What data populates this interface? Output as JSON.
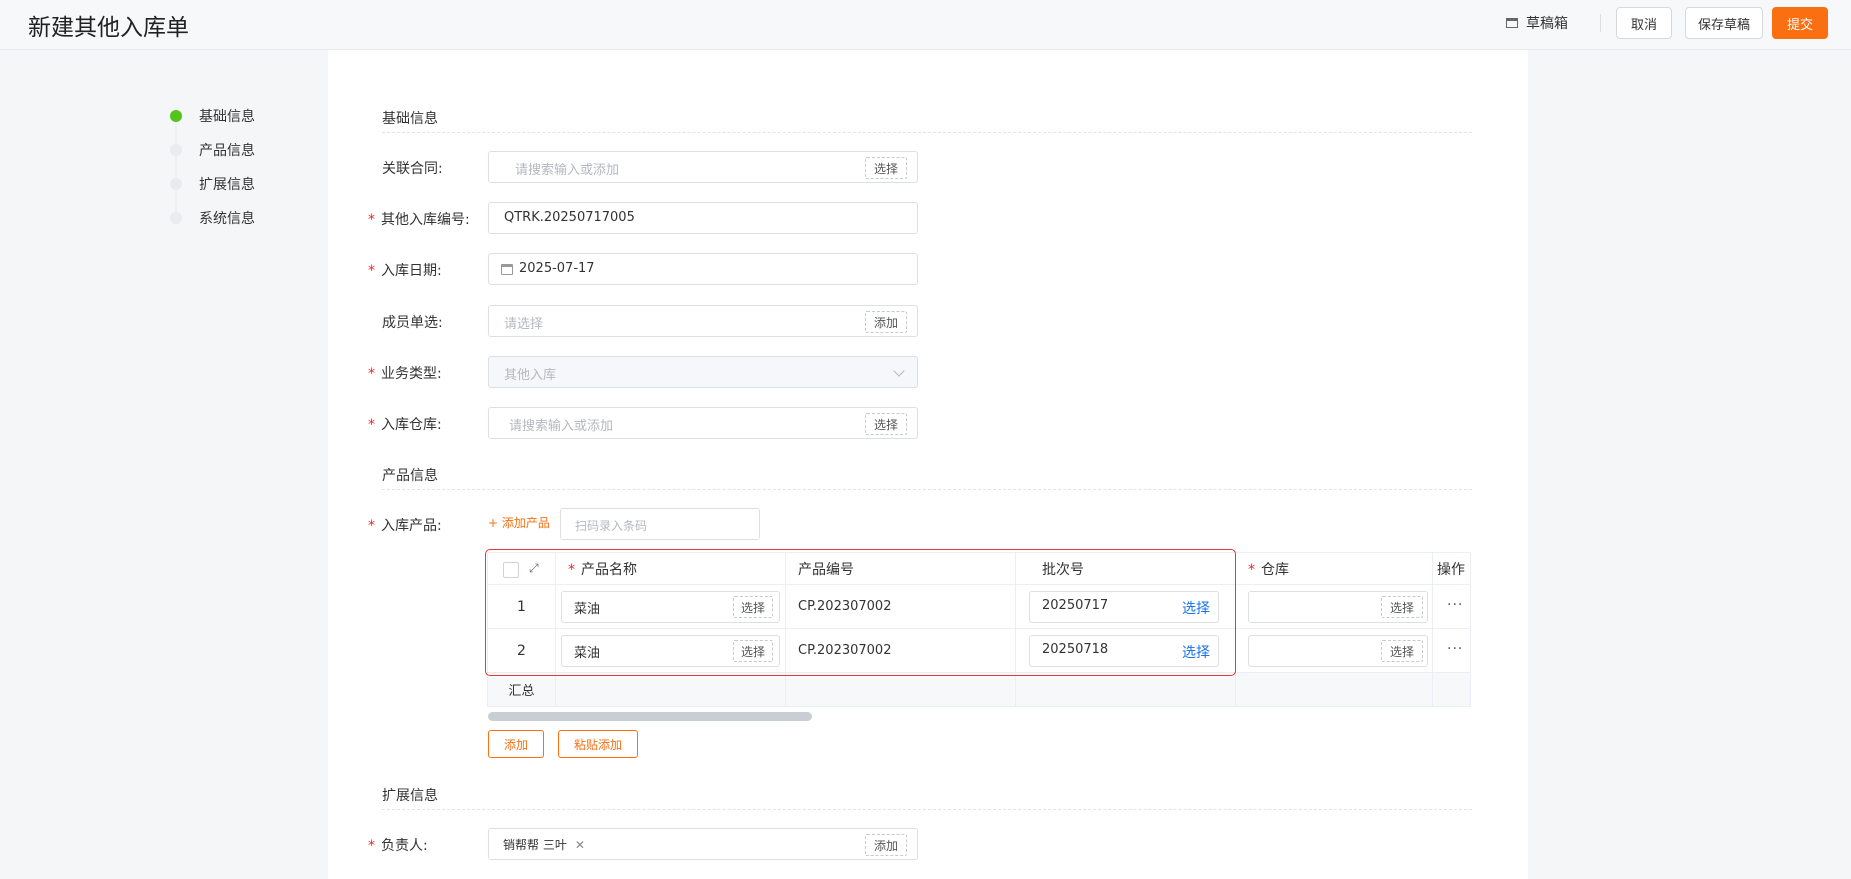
{
  "header": {
    "title": "新建其他入库单",
    "drafts_label": "草稿箱",
    "cancel_label": "取消",
    "save_draft_label": "保存草稿",
    "submit_label": "提交"
  },
  "steps": [
    {
      "label": "基础信息",
      "active": true
    },
    {
      "label": "产品信息",
      "active": false
    },
    {
      "label": "扩展信息",
      "active": false
    },
    {
      "label": "系统信息",
      "active": false
    }
  ],
  "sections": {
    "basic": "基础信息",
    "product": "产品信息",
    "extended": "扩展信息"
  },
  "form": {
    "contract": {
      "label": "关联合同:",
      "placeholder": "请搜索输入或添加",
      "button": "选择"
    },
    "doc_no": {
      "label": "其他入库编号:",
      "value": "QTRK.20250717005"
    },
    "date": {
      "label": "入库日期:",
      "value": "2025-07-17"
    },
    "member": {
      "label": "成员单选:",
      "placeholder": "请选择",
      "button": "添加"
    },
    "biz_type": {
      "label": "业务类型:",
      "value": "其他入库"
    },
    "warehouse": {
      "label": "入库仓库:",
      "placeholder": "请搜索输入或添加",
      "button": "选择"
    },
    "products": {
      "label": "入库产品:",
      "add_link": "+ 添加产品",
      "scan_placeholder": "扫码录入条码"
    },
    "owner": {
      "label": "负责人:",
      "tag": "销帮帮 三叶",
      "button": "添加"
    }
  },
  "table": {
    "columns": [
      "产品名称",
      "产品编号",
      "批次号",
      "仓库",
      "操作"
    ],
    "rows": [
      {
        "index": "1",
        "name": "菜油",
        "name_btn": "选择",
        "code": "CP.202307002",
        "batch": "20250717",
        "batch_btn": "选择",
        "wh_btn": "选择",
        "more": "···"
      },
      {
        "index": "2",
        "name": "菜油",
        "name_btn": "选择",
        "code": "CP.202307002",
        "batch": "20250718",
        "batch_btn": "选择",
        "wh_btn": "选择",
        "more": "···"
      }
    ],
    "summary_label": "汇总",
    "add_label": "添加",
    "paste_add_label": "粘贴添加"
  },
  "colors": {
    "accent": "#fa6f12",
    "active_step": "#52c41a",
    "link": "#1a73e8",
    "highlight_box": "#e53935"
  }
}
